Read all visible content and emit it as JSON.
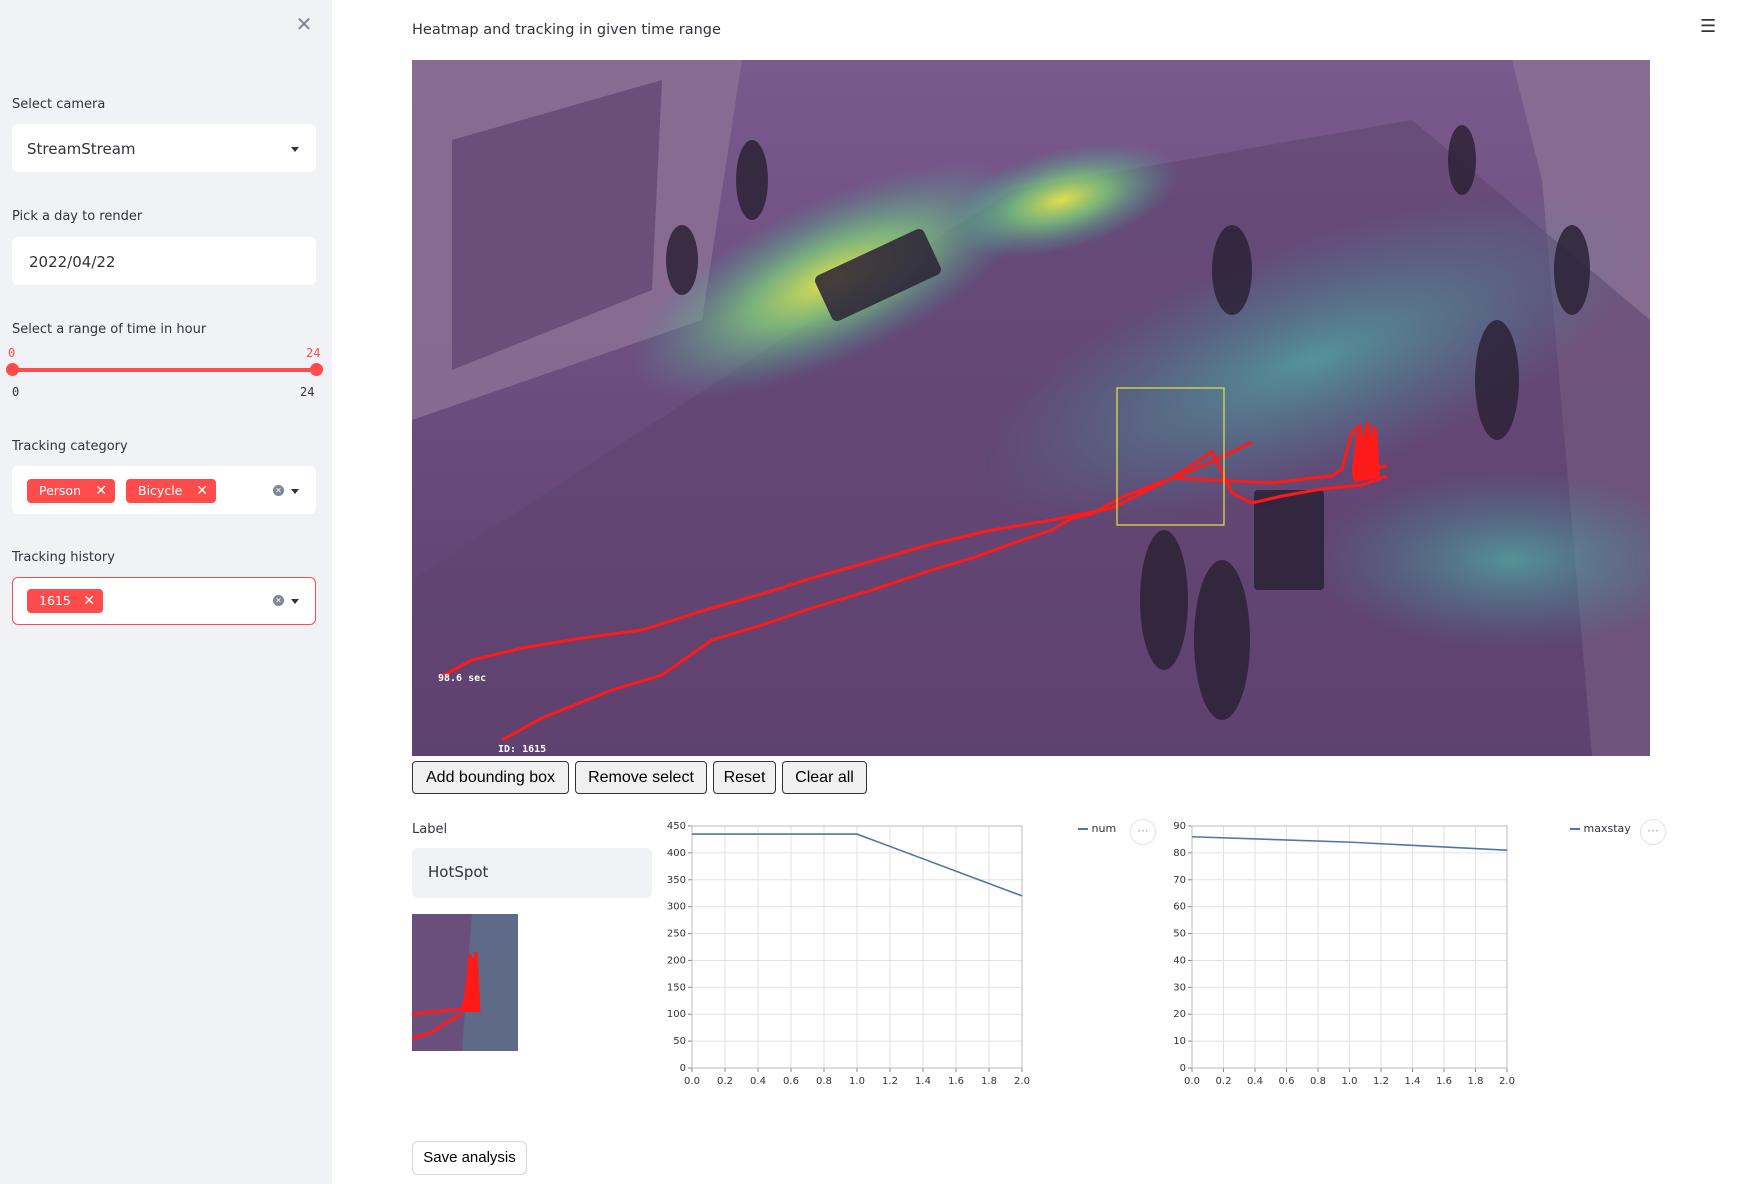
{
  "sidebar": {
    "camera": {
      "label": "Select camera",
      "value": "StreamStream"
    },
    "day": {
      "label": "Pick a day to render",
      "value": "2022/04/22"
    },
    "time_range": {
      "label": "Select a range of time in hour",
      "low": "0",
      "high": "24",
      "min": "0",
      "max": "24",
      "low_value": 0,
      "high_value": 24
    },
    "category": {
      "label": "Tracking category",
      "tags": [
        "Person",
        "Bicycle"
      ]
    },
    "history": {
      "label": "Tracking history",
      "tags": [
        "1615"
      ]
    }
  },
  "main": {
    "title": "Heatmap and tracking in given time range",
    "overlay": {
      "time_text": "98.6 sec",
      "id_text": "ID: 1615"
    },
    "buttons": {
      "add": "Add bounding box",
      "remove": "Remove select",
      "reset": "Reset",
      "clear": "Clear all"
    },
    "label": {
      "title": "Label",
      "value": "HotSpot"
    },
    "save": "Save analysis",
    "colors": {
      "accent": "#ff4b4b",
      "track": "#ff0000",
      "line": "#4c78a8"
    }
  },
  "chart_data": [
    {
      "type": "line",
      "series": [
        {
          "name": "num",
          "x": [
            0.0,
            1.0,
            2.0
          ],
          "values": [
            435,
            435,
            320
          ]
        }
      ],
      "ylim": [
        0,
        450
      ],
      "xlim": [
        0,
        2
      ],
      "yticks": [
        "0",
        "50",
        "100",
        "150",
        "200",
        "250",
        "300",
        "350",
        "400",
        "450"
      ],
      "xticks": [
        "0.0",
        "0.2",
        "0.4",
        "0.6",
        "0.8",
        "1.0",
        "1.2",
        "1.4",
        "1.6",
        "1.8",
        "2.0"
      ],
      "grid": true,
      "legend": "top-right"
    },
    {
      "type": "line",
      "series": [
        {
          "name": "maxstay",
          "x": [
            0.0,
            1.0,
            2.0
          ],
          "values": [
            86,
            84,
            81
          ]
        }
      ],
      "ylim": [
        0,
        90
      ],
      "xlim": [
        0,
        2
      ],
      "yticks": [
        "0",
        "10",
        "20",
        "30",
        "40",
        "50",
        "60",
        "70",
        "80",
        "90"
      ],
      "xticks": [
        "0.0",
        "0.2",
        "0.4",
        "0.6",
        "0.8",
        "1.0",
        "1.2",
        "1.4",
        "1.6",
        "1.8",
        "2.0"
      ],
      "grid": true,
      "legend": "top-right"
    }
  ]
}
